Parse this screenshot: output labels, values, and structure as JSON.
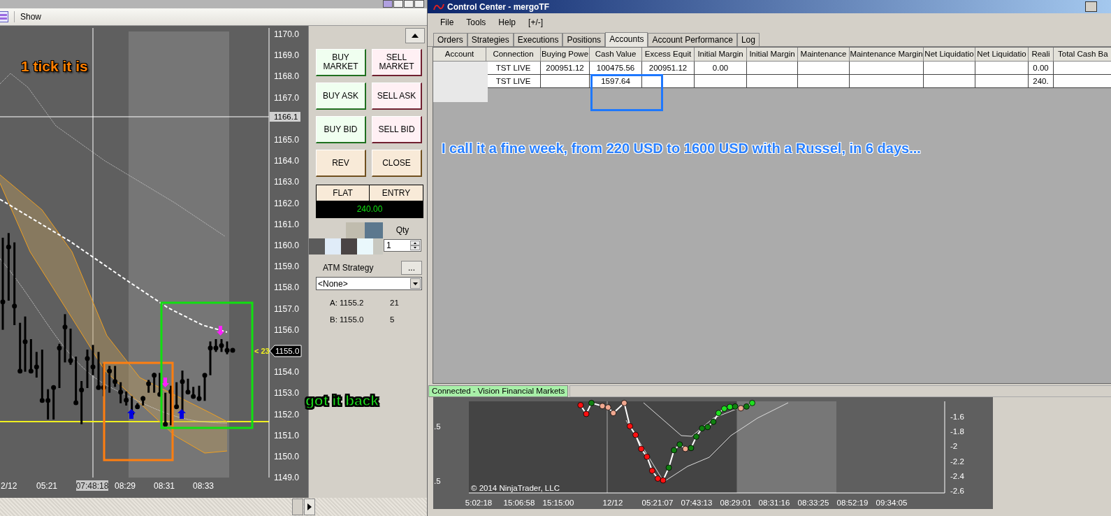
{
  "chart_window": {
    "toolbar": {
      "show_label": "Show"
    },
    "price_axis": [
      "1170.0",
      "1169.0",
      "1168.0",
      "1167.0",
      "1165.0",
      "1164.0",
      "1163.0",
      "1162.0",
      "1161.0",
      "1160.0",
      "1159.0",
      "1158.0",
      "1157.0",
      "1156.0",
      "1154.0",
      "1153.0",
      "1152.0",
      "1151.0",
      "1150.0",
      "1149.0"
    ],
    "time_axis": [
      {
        "label": "2/12",
        "kind": "tick"
      },
      {
        "label": "05:21",
        "kind": "tick"
      },
      {
        "label": "07:48:18",
        "kind": "crosshair"
      },
      {
        "label": "08:29",
        "kind": "tick"
      },
      {
        "label": "08:31",
        "kind": "tick"
      },
      {
        "label": "08:33",
        "kind": "tick"
      }
    ],
    "crosshair_price": "1166.1",
    "last_price": "1155.0",
    "countdown": "< 23",
    "annotations": [
      {
        "text": "1 tick it is",
        "color": "#ff7f00"
      },
      {
        "text": "got it back",
        "color": "#1ee01e"
      }
    ]
  },
  "order_entry": {
    "buttons": [
      {
        "label": "BUY MARKET",
        "kind": "buy"
      },
      {
        "label": "SELL MARKET",
        "kind": "sell"
      },
      {
        "label": "BUY ASK",
        "kind": "buy"
      },
      {
        "label": "SELL ASK",
        "kind": "sell"
      },
      {
        "label": "BUY BID",
        "kind": "buy"
      },
      {
        "label": "SELL BID",
        "kind": "sell"
      },
      {
        "label": "REV",
        "kind": "neutral"
      },
      {
        "label": "CLOSE",
        "kind": "neutral"
      }
    ],
    "position": {
      "status": "FLAT",
      "entry_label": "ENTRY",
      "pnl": "240.00"
    },
    "qty_label": "Qty",
    "qty_value": "1",
    "atm_label": "ATM Strategy",
    "atm_button": "...",
    "atm_value": "<None>",
    "quotes": [
      {
        "label": "A: 1155.2",
        "size": "21"
      },
      {
        "label": "B: 1155.0",
        "size": "5"
      }
    ]
  },
  "control_center": {
    "title": "Control Center - mergoTF",
    "menu": [
      "File",
      "Tools",
      "Help",
      "[+/-]"
    ],
    "tabs": [
      {
        "label": "Orders",
        "selected": false
      },
      {
        "label": "Strategies",
        "selected": false
      },
      {
        "label": "Executions",
        "selected": false
      },
      {
        "label": "Positions",
        "selected": false
      },
      {
        "label": "Accounts",
        "selected": true
      },
      {
        "label": "Account Performance",
        "selected": false
      },
      {
        "label": "Log",
        "selected": false
      }
    ],
    "table": {
      "columns": [
        "Account",
        "Connection",
        "Buying Powe",
        "Cash Value",
        "Excess Equit",
        "Initial Margin",
        "Initial Margin",
        "Maintenance",
        "Maintenance Margin",
        "Net Liquidatio",
        "Net Liquidatio",
        "Reali",
        "Total Cash Ba"
      ],
      "rows": [
        [
          "",
          "TST LIVE",
          "200951.12",
          "100475.56",
          "200951.12",
          "0.00",
          "",
          "",
          "",
          "",
          "",
          "0.00",
          ""
        ],
        [
          "",
          "TST LIVE",
          "",
          "1597.64",
          "",
          "",
          "",
          "",
          "",
          "",
          "",
          "240.",
          ""
        ]
      ]
    },
    "annotation": "I call it a fine week, from 220 USD to 1600 USD with a Russel, in 6 days...",
    "status": "Connected - Vision Financial Markets"
  },
  "lower_chart": {
    "left_axis": [
      ".5",
      ".5"
    ],
    "y_axis": [
      "-1.6",
      "-1.8",
      "-2",
      "-2.2",
      "-2.4",
      "-2.6"
    ],
    "x_axis": [
      "5:02:18",
      "15:06:58",
      "15:15:00",
      "12/12",
      "05:21:07",
      "07:43:13",
      "08:29:01",
      "08:31:16",
      "08:33:25",
      "08:52:19",
      "09:34:05"
    ],
    "copyright": "© 2014 NinjaTrader, LLC"
  }
}
